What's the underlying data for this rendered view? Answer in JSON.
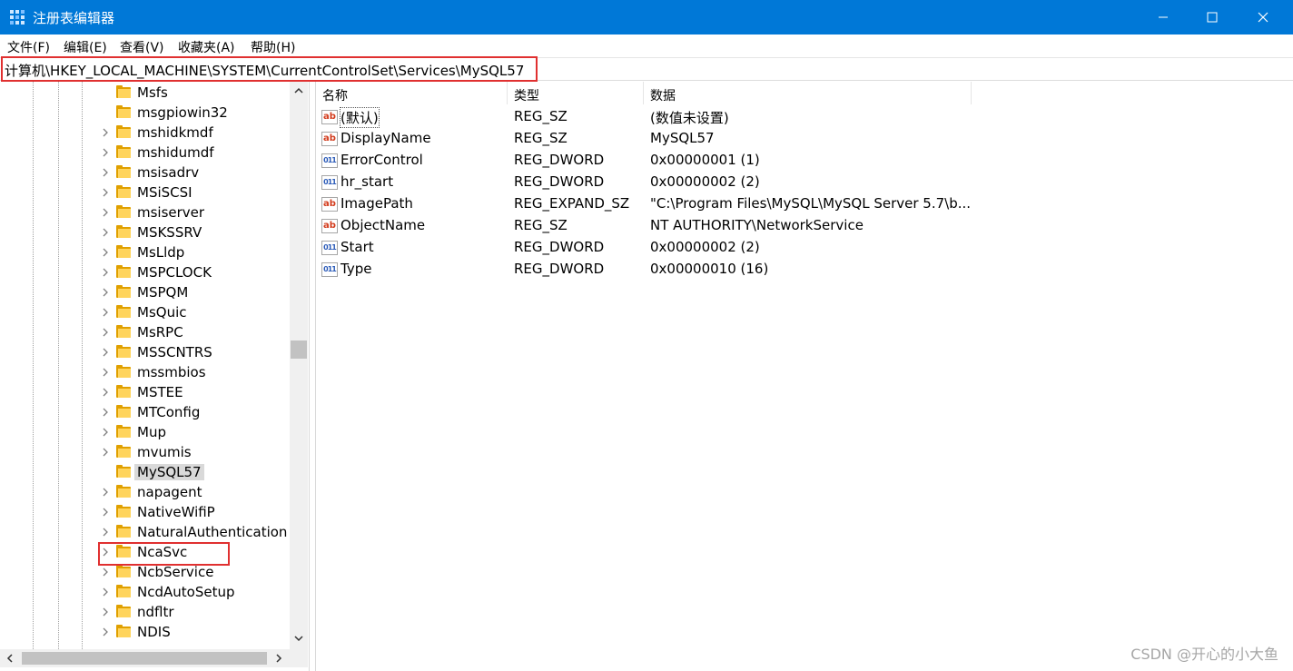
{
  "window": {
    "title": "注册表编辑器",
    "controls": [
      "minimize",
      "maximize",
      "close"
    ]
  },
  "menu": [
    "文件(F)",
    "编辑(E)",
    "查看(V)",
    "收藏夹(A)",
    "帮助(H)"
  ],
  "address": {
    "path": "计算机\\HKEY_LOCAL_MACHINE\\SYSTEM\\CurrentControlSet\\Services\\MySQL57"
  },
  "tree": {
    "items": [
      {
        "label": "Msfs",
        "expandable": false
      },
      {
        "label": "msgpiowin32",
        "expandable": false
      },
      {
        "label": "mshidkmdf",
        "expandable": true
      },
      {
        "label": "mshidumdf",
        "expandable": true
      },
      {
        "label": "msisadrv",
        "expandable": true
      },
      {
        "label": "MSiSCSI",
        "expandable": true
      },
      {
        "label": "msiserver",
        "expandable": true
      },
      {
        "label": "MSKSSRV",
        "expandable": true
      },
      {
        "label": "MsLldp",
        "expandable": true
      },
      {
        "label": "MSPCLOCK",
        "expandable": true
      },
      {
        "label": "MSPQM",
        "expandable": true
      },
      {
        "label": "MsQuic",
        "expandable": true
      },
      {
        "label": "MsRPC",
        "expandable": true
      },
      {
        "label": "MSSCNTRS",
        "expandable": true
      },
      {
        "label": "mssmbios",
        "expandable": true
      },
      {
        "label": "MSTEE",
        "expandable": true
      },
      {
        "label": "MTConfig",
        "expandable": true
      },
      {
        "label": "Mup",
        "expandable": true
      },
      {
        "label": "mvumis",
        "expandable": true
      },
      {
        "label": "MySQL57",
        "expandable": false,
        "selected": true
      },
      {
        "label": "napagent",
        "expandable": true
      },
      {
        "label": "NativeWifiP",
        "expandable": true
      },
      {
        "label": "NaturalAuthentication",
        "expandable": true
      },
      {
        "label": "NcaSvc",
        "expandable": true
      },
      {
        "label": "NcbService",
        "expandable": true
      },
      {
        "label": "NcdAutoSetup",
        "expandable": true
      },
      {
        "label": "ndfltr",
        "expandable": true
      },
      {
        "label": "NDIS",
        "expandable": true
      }
    ]
  },
  "list": {
    "headers": {
      "name": "名称",
      "type": "类型",
      "data": "数据"
    },
    "rows": [
      {
        "icon": "string-value-icon",
        "name": "(默认)",
        "type": "REG_SZ",
        "data": "(数值未设置)"
      },
      {
        "icon": "string-value-icon",
        "name": "DisplayName",
        "type": "REG_SZ",
        "data": "MySQL57"
      },
      {
        "icon": "binary-value-icon",
        "name": "ErrorControl",
        "type": "REG_DWORD",
        "data": "0x00000001 (1)"
      },
      {
        "icon": "binary-value-icon",
        "name": "hr_start",
        "type": "REG_DWORD",
        "data": "0x00000002 (2)"
      },
      {
        "icon": "string-value-icon",
        "name": "ImagePath",
        "type": "REG_EXPAND_SZ",
        "data": "\"C:\\Program Files\\MySQL\\MySQL Server 5.7\\b..."
      },
      {
        "icon": "string-value-icon",
        "name": "ObjectName",
        "type": "REG_SZ",
        "data": "NT AUTHORITY\\NetworkService"
      },
      {
        "icon": "binary-value-icon",
        "name": "Start",
        "type": "REG_DWORD",
        "data": "0x00000002 (2)"
      },
      {
        "icon": "binary-value-icon",
        "name": "Type",
        "type": "REG_DWORD",
        "data": "0x00000010 (16)"
      }
    ]
  },
  "icon_glyphs": {
    "string": "ab",
    "binary": "011"
  },
  "watermark": "CSDN @开心的小大鱼",
  "colors": {
    "titlebar": "#0078d7",
    "highlight_box": "#e03030",
    "folder": "#ffd45c"
  }
}
